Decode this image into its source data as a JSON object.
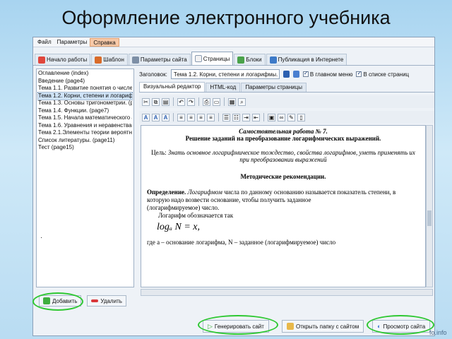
{
  "slide": {
    "title": "Оформление электронного учебника"
  },
  "menu": [
    "Файл",
    "Параметры",
    "Справка"
  ],
  "top_tabs": [
    "Начало работы",
    "Шаблон",
    "Параметры сайта",
    "Страницы",
    "Блоки",
    "Публикация в Интернете"
  ],
  "tree": [
    "Оглавление (index)",
    "Введение (page4)",
    "Тема 1.1. Развитие понятия о числе.",
    "Тема 1.2. Корни, степени и логарифм",
    "Тема 1.3. Основы тригонометрии. (p",
    "Тема 1.4. Функции. (page7)",
    "Тема 1.5. Начала математического а",
    "Тема 1.6. Уравнения и неравенства.",
    "Тема 2.1.Элементы теории вероятн.",
    "Список литературы. (page11)",
    "Тест (page15)"
  ],
  "left_buttons": {
    "add": "Добавить",
    "delete": "Удалить"
  },
  "header": {
    "label": "Заголовок:",
    "value": "Тема 1.2. Корни, степени и логарифмы.",
    "check_main_menu": "В главном меню",
    "check_page_list": "В списке страниц"
  },
  "editor_tabs": [
    "Визуальный редактор",
    "HTML-код",
    "Параметры страницы"
  ],
  "document": {
    "h1": "Самостоятельная работа № 7.",
    "h2": "Решение заданий на преобразование логарифмических выражений.",
    "goal_label": "Цель:",
    "goal_text": "Знать основное логарифмическое тождество, свойства логарифмов, уметь применять их при преобразовании выражений",
    "method": "Методические рекомендации.",
    "def_label": "Определение.",
    "def_term": "Логарифмом",
    "def_text": "числа по данному основанию называется показатель степени, в которую надо возвести основание, чтобы получить заданное",
    "def_tail": "(логарифмируемое) число.",
    "notation": "Логарифм обозначается так",
    "formula": "logₐ N = x,",
    "cut_line": "где a – основание логарифма, N – заданное (логарифмируемое) число"
  },
  "bottom_buttons": {
    "generate": "Генерировать сайт",
    "open_folder": "Открыть папку с сайтом",
    "preview": "Просмотр сайта"
  },
  "watermark": "fo.info",
  "colors": {
    "ring": "#2ec832",
    "selection": "#cfe3f7",
    "active_menu": "#f7c9a8"
  }
}
